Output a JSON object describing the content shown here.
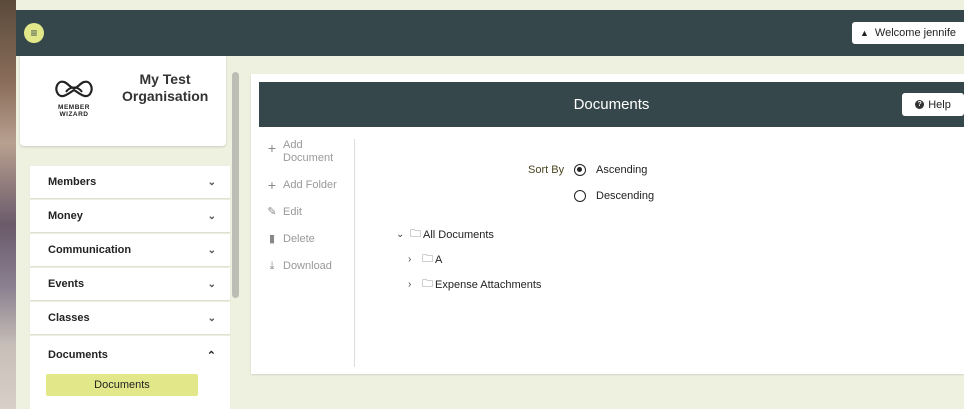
{
  "header": {
    "welcome_text": "Welcome jennife"
  },
  "sidebar": {
    "org_name": "My Test Organisation",
    "logo_text": "MEMBER WIZARD",
    "nav": [
      {
        "label": "Members"
      },
      {
        "label": "Money"
      },
      {
        "label": "Communication"
      },
      {
        "label": "Events"
      },
      {
        "label": "Classes"
      }
    ],
    "open_section": {
      "label": "Documents",
      "sub_label": "Documents"
    }
  },
  "main": {
    "title": "Documents",
    "help_label": "Help",
    "actions": [
      {
        "label": "Add Document",
        "icon": "plus-icon"
      },
      {
        "label": "Add Folder",
        "icon": "plus-icon"
      },
      {
        "label": "Edit",
        "icon": "pencil-icon"
      },
      {
        "label": "Delete",
        "icon": "trash-icon"
      },
      {
        "label": "Download",
        "icon": "download-icon"
      }
    ],
    "sort": {
      "label": "Sort By",
      "options": [
        "Ascending",
        "Descending"
      ],
      "selected": "Ascending"
    },
    "tree": {
      "root": "All Documents",
      "children": [
        "A",
        "Expense Attachments"
      ]
    }
  },
  "colors": {
    "header_bg": "#35474b",
    "accent": "#e2e88a",
    "page_bg": "#eef1e0"
  }
}
